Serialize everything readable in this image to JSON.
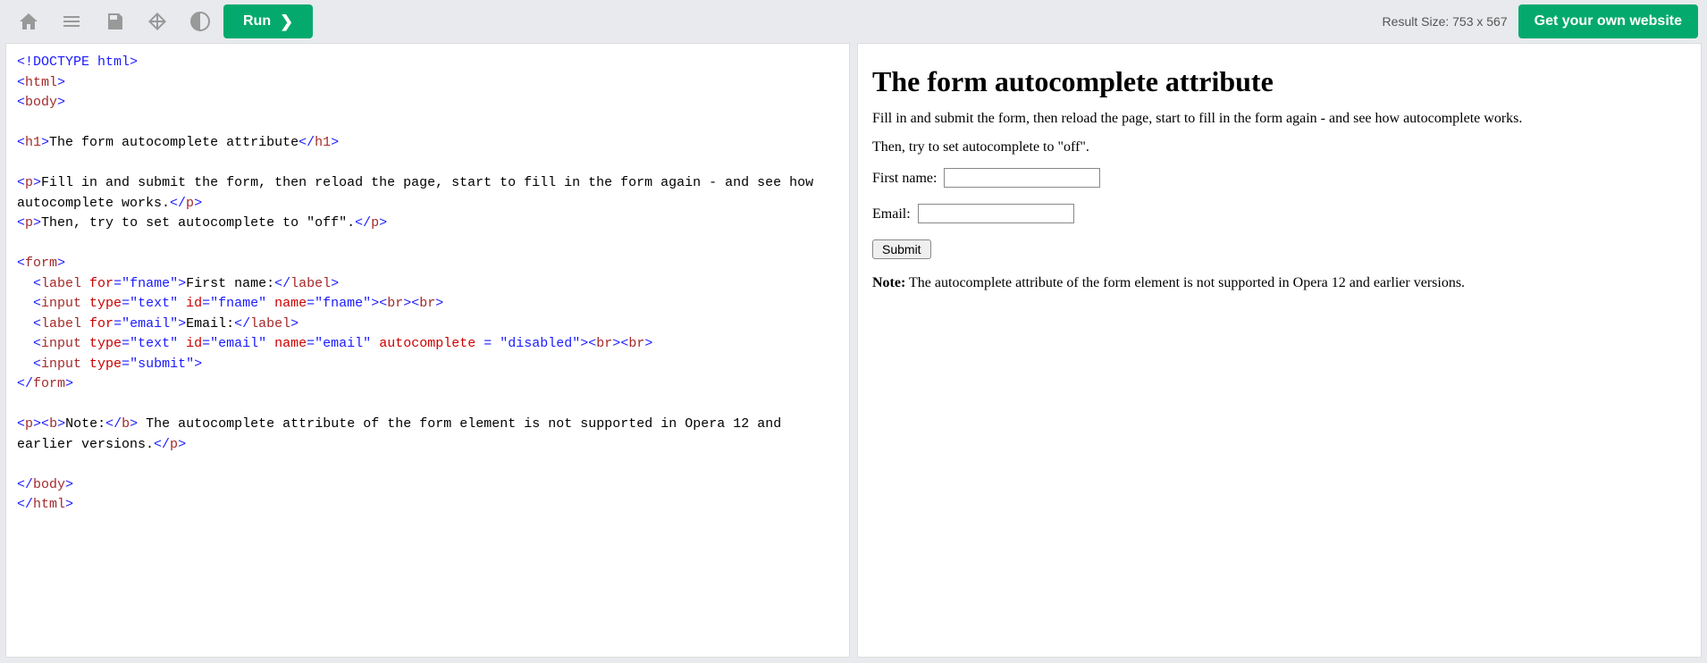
{
  "toolbar": {
    "run_label": "Run",
    "result_size": "Result Size: 753 x 567",
    "cta_label": "Get your own website"
  },
  "code": {
    "l1": "<!DOCTYPE html>",
    "l2_open": "<",
    "l2_tag": "html",
    "l2_close": ">",
    "l3_open": "<",
    "l3_tag": "body",
    "l3_close": ">",
    "l5_open": "<",
    "l5_tag": "h1",
    "l5_close": ">",
    "l5_text": "The form autocomplete attribute",
    "l5_end_open": "</",
    "l5_end_tag": "h1",
    "l5_end_close": ">",
    "l7_open": "<",
    "l7_tag": "p",
    "l7_close": ">",
    "l7_text": "Fill in and submit the form, then reload the page, start to fill in the form again - and see how autocomplete works.",
    "l7_end_open": "</",
    "l7_end_tag": "p",
    "l7_end_close": ">",
    "l8_open": "<",
    "l8_tag": "p",
    "l8_close": ">",
    "l8_text": "Then, try to set autocomplete to \"off\".",
    "l8_end_open": "</",
    "l8_end_tag": "p",
    "l8_end_close": ">",
    "l10_open": "<",
    "l10_tag": "form",
    "l10_close": ">",
    "l11_pre": "  ",
    "l11_open": "<",
    "l11_tag": "label",
    "l11_attr1_name": " for",
    "l11_attr1_eq": "=",
    "l11_attr1_val": "\"fname\"",
    "l11_close": ">",
    "l11_text": "First name:",
    "l11_end_open": "</",
    "l11_end_tag": "label",
    "l11_end_close": ">",
    "l12_pre": "  ",
    "l12_open": "<",
    "l12_tag": "input",
    "l12_attr1_name": " type",
    "l12_attr1_eq": "=",
    "l12_attr1_val": "\"text\"",
    "l12_attr2_name": " id",
    "l12_attr2_eq": "=",
    "l12_attr2_val": "\"fname\"",
    "l12_attr3_name": " name",
    "l12_attr3_eq": "=",
    "l12_attr3_val": "\"fname\"",
    "l12_close": ">",
    "l12_br1_open": "<",
    "l12_br1_tag": "br",
    "l12_br1_close": ">",
    "l12_br2_open": "<",
    "l12_br2_tag": "br",
    "l12_br2_close": ">",
    "l13_pre": "  ",
    "l13_open": "<",
    "l13_tag": "label",
    "l13_attr1_name": " for",
    "l13_attr1_eq": "=",
    "l13_attr1_val": "\"email\"",
    "l13_close": ">",
    "l13_text": "Email:",
    "l13_end_open": "</",
    "l13_end_tag": "label",
    "l13_end_close": ">",
    "l14_pre": "  ",
    "l14_open": "<",
    "l14_tag": "input",
    "l14_attr1_name": " type",
    "l14_attr1_eq": "=",
    "l14_attr1_val": "\"text\"",
    "l14_attr2_name": " id",
    "l14_attr2_eq": "=",
    "l14_attr2_val": "\"email\"",
    "l14_attr3_name": " name",
    "l14_attr3_eq": "=",
    "l14_attr3_val": "\"email\"",
    "l14_attr4_name": " autocomplete ",
    "l14_attr4_eq": "= ",
    "l14_attr4_val": "\"disabled\"",
    "l14_close": ">",
    "l14_br1_open": "<",
    "l14_br1_tag": "br",
    "l14_br1_close": ">",
    "l14_br2_open": "<",
    "l14_br2_tag": "br",
    "l14_br2_close": ">",
    "l15_pre": "  ",
    "l15_open": "<",
    "l15_tag": "input",
    "l15_attr1_name": " type",
    "l15_attr1_eq": "=",
    "l15_attr1_val": "\"submit\"",
    "l15_close": ">",
    "l16_open": "</",
    "l16_tag": "form",
    "l16_close": ">",
    "l18_open": "<",
    "l18_tag": "p",
    "l18_close": ">",
    "l18_bopen": "<",
    "l18_btag": "b",
    "l18_bclose": ">",
    "l18_btext": "Note:",
    "l18_bend_open": "</",
    "l18_bend_tag": "b",
    "l18_bend_close": ">",
    "l18_text": " The autocomplete attribute of the form element is not supported in Opera 12 and earlier versions.",
    "l18_end_open": "</",
    "l18_end_tag": "p",
    "l18_end_close": ">",
    "l20_open": "</",
    "l20_tag": "body",
    "l20_close": ">",
    "l21_open": "</",
    "l21_tag": "html",
    "l21_close": ">"
  },
  "preview": {
    "h1": "The form autocomplete attribute",
    "p1": "Fill in and submit the form, then reload the page, start to fill in the form again - and see how autocomplete works.",
    "p2": "Then, try to set autocomplete to \"off\".",
    "label_fname": "First name:",
    "label_email": "Email:",
    "submit_value": "Submit",
    "note_bold": "Note:",
    "note_text": " The autocomplete attribute of the form element is not supported in Opera 12 and earlier versions."
  }
}
